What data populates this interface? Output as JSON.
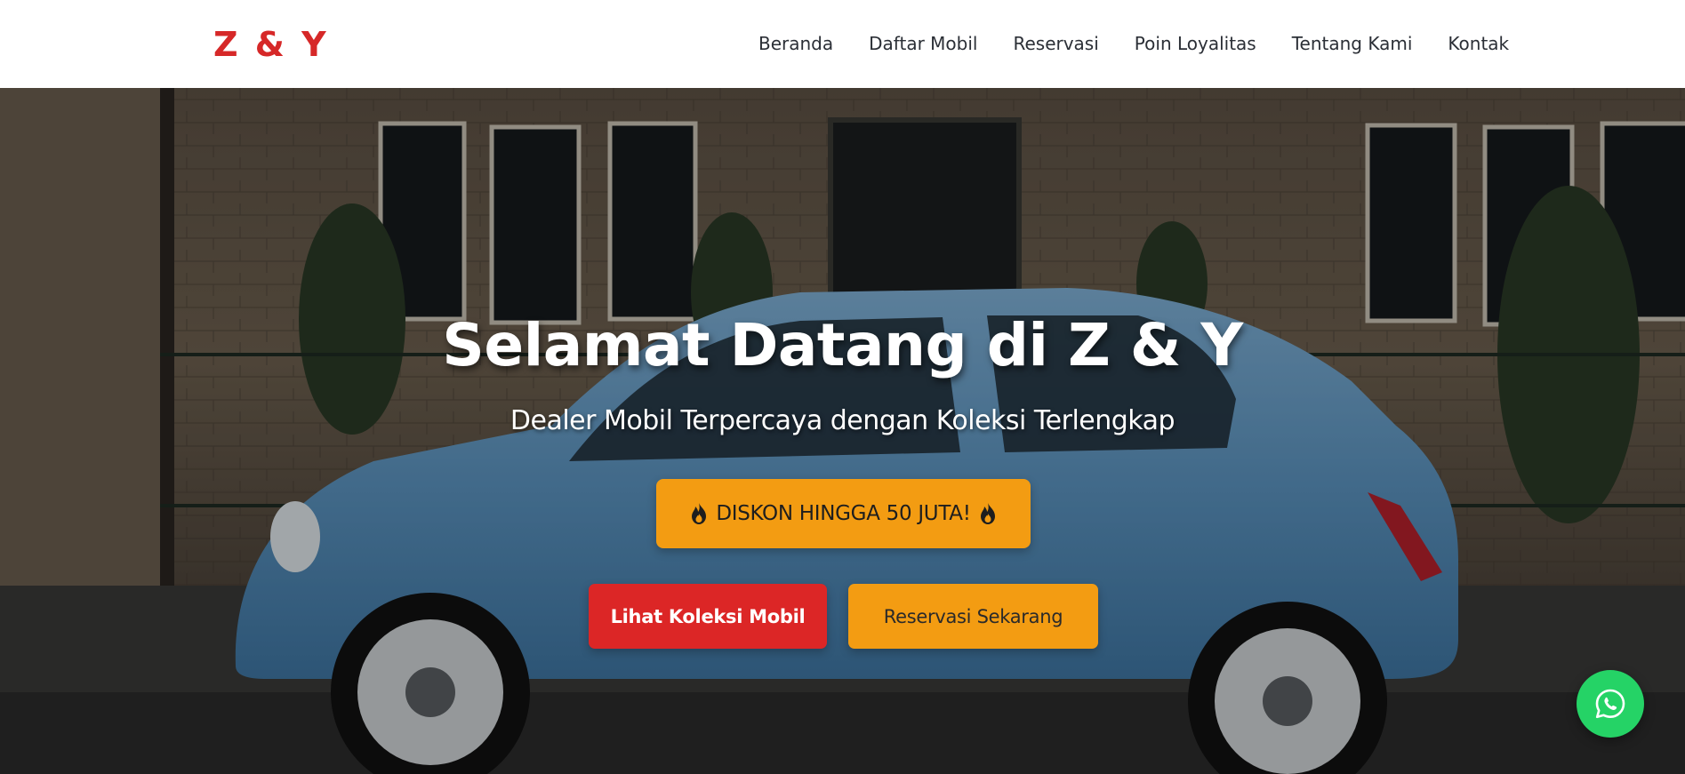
{
  "header": {
    "logo": "Z & Y",
    "nav": [
      {
        "label": "Beranda"
      },
      {
        "label": "Daftar Mobil"
      },
      {
        "label": "Reservasi"
      },
      {
        "label": "Poin Loyalitas"
      },
      {
        "label": "Tentang Kami"
      },
      {
        "label": "Kontak"
      }
    ]
  },
  "hero": {
    "title": "Selamat Datang di Z & Y",
    "subtitle": "Dealer Mobil Terpercaya dengan Koleksi Terlengkap",
    "promo": {
      "text": "DISKON HINGGA 50 JUTA!",
      "icon": "fire-icon"
    },
    "buttons": {
      "primary": "Lihat Koleksi Mobil",
      "secondary": "Reservasi Sekarang"
    }
  },
  "floating": {
    "whatsapp_icon": "whatsapp-icon"
  },
  "colors": {
    "brand_red": "#dc2626",
    "accent_orange": "#f39c12",
    "whatsapp_green": "#25d366",
    "car_blue": "#5b93bf"
  }
}
